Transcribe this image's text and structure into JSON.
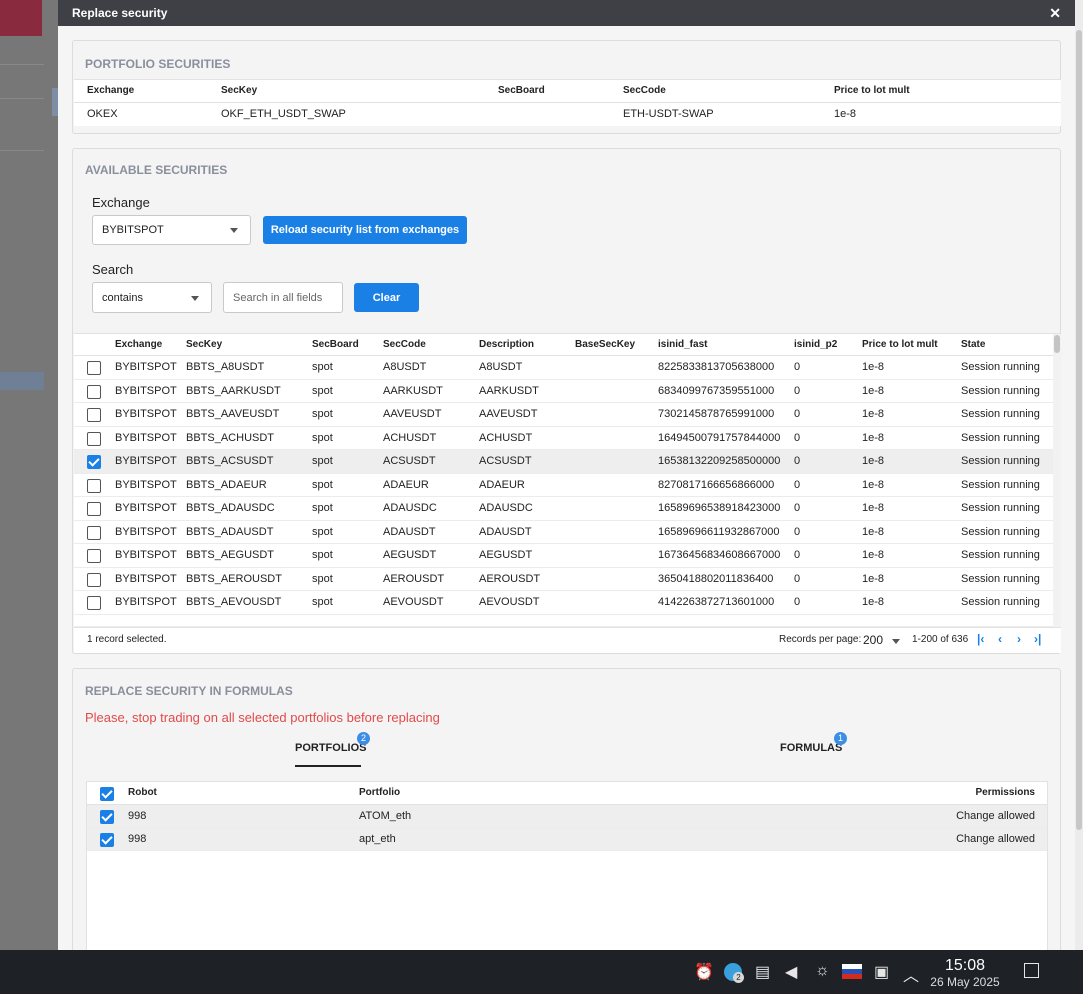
{
  "dialog": {
    "title": "Replace security",
    "close": "✕"
  },
  "portfolio_securities": {
    "title": "PORTFOLIO SECURITIES",
    "columns": [
      "Exchange",
      "SecKey",
      "SecBoard",
      "SecCode",
      "Price to lot mult"
    ],
    "row": {
      "exchange": "OKEX",
      "seckey": "OKF_ETH_USDT_SWAP",
      "secboard": "",
      "seccode": "ETH-USDT-SWAP",
      "price_mult": "1e-8"
    }
  },
  "available_securities": {
    "title": "AVAILABLE SECURITIES",
    "exchange_label": "Exchange",
    "exchange_value": "BYBITSPOT",
    "reload_button": "Reload security list from exchanges",
    "search_label": "Search",
    "search_mode": "contains",
    "search_placeholder": "Search in all fields",
    "clear_button": "Clear",
    "columns": [
      "Exchange",
      "SecKey",
      "SecBoard",
      "SecCode",
      "Description",
      "BaseSecKey",
      "isinid_fast",
      "isinid_p2",
      "Price to lot mult",
      "State"
    ],
    "rows": [
      {
        "checked": false,
        "exchange": "BYBITSPOT",
        "seckey": "BBTS_A8USDT",
        "secboard": "spot",
        "seccode": "A8USDT",
        "description": "A8USDT",
        "basesec": "",
        "isinid_fast": "8225833813705638000",
        "isinid_p2": "0",
        "price_mult": "1e-8",
        "state": "Session running"
      },
      {
        "checked": false,
        "exchange": "BYBITSPOT",
        "seckey": "BBTS_AARKUSDT",
        "secboard": "spot",
        "seccode": "AARKUSDT",
        "description": "AARKUSDT",
        "basesec": "",
        "isinid_fast": "6834099767359551000",
        "isinid_p2": "0",
        "price_mult": "1e-8",
        "state": "Session running"
      },
      {
        "checked": false,
        "exchange": "BYBITSPOT",
        "seckey": "BBTS_AAVEUSDT",
        "secboard": "spot",
        "seccode": "AAVEUSDT",
        "description": "AAVEUSDT",
        "basesec": "",
        "isinid_fast": "7302145878765991000",
        "isinid_p2": "0",
        "price_mult": "1e-8",
        "state": "Session running"
      },
      {
        "checked": false,
        "exchange": "BYBITSPOT",
        "seckey": "BBTS_ACHUSDT",
        "secboard": "spot",
        "seccode": "ACHUSDT",
        "description": "ACHUSDT",
        "basesec": "",
        "isinid_fast": "16494500791757844000",
        "isinid_p2": "0",
        "price_mult": "1e-8",
        "state": "Session running"
      },
      {
        "checked": true,
        "exchange": "BYBITSPOT",
        "seckey": "BBTS_ACSUSDT",
        "secboard": "spot",
        "seccode": "ACSUSDT",
        "description": "ACSUSDT",
        "basesec": "",
        "isinid_fast": "16538132209258500000",
        "isinid_p2": "0",
        "price_mult": "1e-8",
        "state": "Session running"
      },
      {
        "checked": false,
        "exchange": "BYBITSPOT",
        "seckey": "BBTS_ADAEUR",
        "secboard": "spot",
        "seccode": "ADAEUR",
        "description": "ADAEUR",
        "basesec": "",
        "isinid_fast": "8270817166656866000",
        "isinid_p2": "0",
        "price_mult": "1e-8",
        "state": "Session running"
      },
      {
        "checked": false,
        "exchange": "BYBITSPOT",
        "seckey": "BBTS_ADAUSDC",
        "secboard": "spot",
        "seccode": "ADAUSDC",
        "description": "ADAUSDC",
        "basesec": "",
        "isinid_fast": "16589696538918423000",
        "isinid_p2": "0",
        "price_mult": "1e-8",
        "state": "Session running"
      },
      {
        "checked": false,
        "exchange": "BYBITSPOT",
        "seckey": "BBTS_ADAUSDT",
        "secboard": "spot",
        "seccode": "ADAUSDT",
        "description": "ADAUSDT",
        "basesec": "",
        "isinid_fast": "16589696611932867000",
        "isinid_p2": "0",
        "price_mult": "1e-8",
        "state": "Session running"
      },
      {
        "checked": false,
        "exchange": "BYBITSPOT",
        "seckey": "BBTS_AEGUSDT",
        "secboard": "spot",
        "seccode": "AEGUSDT",
        "description": "AEGUSDT",
        "basesec": "",
        "isinid_fast": "16736456834608667000",
        "isinid_p2": "0",
        "price_mult": "1e-8",
        "state": "Session running"
      },
      {
        "checked": false,
        "exchange": "BYBITSPOT",
        "seckey": "BBTS_AEROUSDT",
        "secboard": "spot",
        "seccode": "AEROUSDT",
        "description": "AEROUSDT",
        "basesec": "",
        "isinid_fast": "3650418802011836400",
        "isinid_p2": "0",
        "price_mult": "1e-8",
        "state": "Session running"
      },
      {
        "checked": false,
        "exchange": "BYBITSPOT",
        "seckey": "BBTS_AEVOUSDT",
        "secboard": "spot",
        "seccode": "AEVOUSDT",
        "description": "AEVOUSDT",
        "basesec": "",
        "isinid_fast": "4142263872713601000",
        "isinid_p2": "0",
        "price_mult": "1e-8",
        "state": "Session running"
      }
    ],
    "footer": {
      "selected": "1 record selected.",
      "rpp_label": "Records per page:",
      "rpp_value": "200",
      "range": "1-200 of 636"
    }
  },
  "replace": {
    "title": "REPLACE SECURITY IN FORMULAS",
    "warning": "Please, stop trading on all selected portfolios before replacing",
    "tabs": [
      {
        "label": "PORTFOLIOS",
        "badge": "2"
      },
      {
        "label": "FORMULAS",
        "badge": "1"
      }
    ],
    "columns": [
      "Robot",
      "Portfolio",
      "Permissions"
    ],
    "rows": [
      {
        "robot": "998",
        "portfolio": "ATOM_eth",
        "permissions": "Change allowed"
      },
      {
        "robot": "998",
        "portfolio": "apt_eth",
        "permissions": "Change allowed"
      }
    ]
  },
  "taskbar": {
    "time": "15:08",
    "date": "26 May 2025",
    "telegram_badge": "2",
    "icons": [
      "notifications-icon",
      "telegram-icon",
      "clipboard-icon",
      "volume-icon",
      "brightness-icon",
      "language-flag-icon",
      "network-icon",
      "tray-expand-icon",
      "show-desktop-icon"
    ]
  }
}
